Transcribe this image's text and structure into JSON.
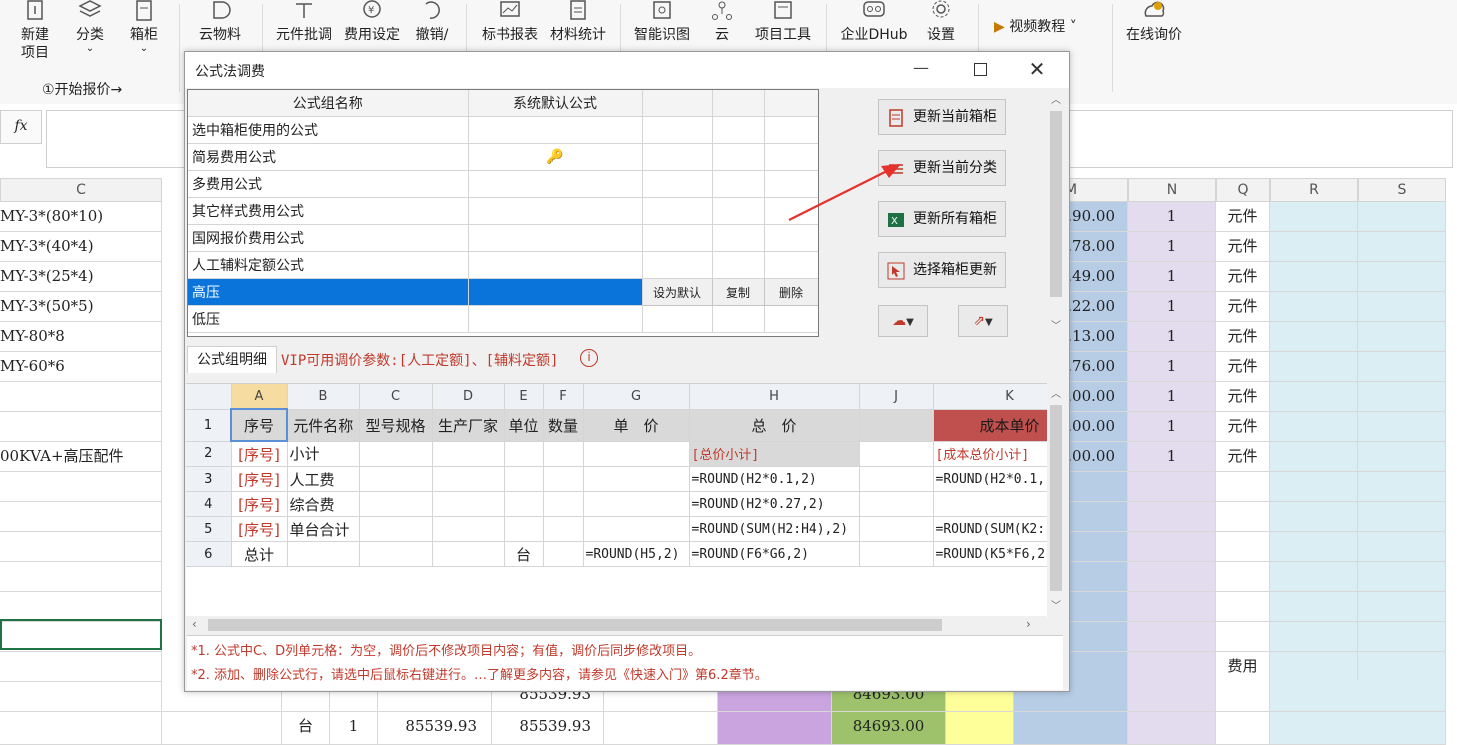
{
  "ribbon": {
    "buttons": [
      {
        "label": "新建\n项目",
        "icon": "new-project-icon"
      },
      {
        "label": "分类",
        "icon": "category-icon"
      },
      {
        "label": "箱柜",
        "icon": "cabinet-icon"
      },
      {
        "label": "云物料",
        "icon": "cloud-material-icon"
      },
      {
        "label": "元件批调",
        "icon": "component-batch-icon"
      },
      {
        "label": "费用设定",
        "icon": "fee-setting-icon"
      },
      {
        "label": "撤销/",
        "icon": "undo-icon"
      },
      {
        "label": "标书报表",
        "icon": "bid-report-icon"
      },
      {
        "label": "材料统计",
        "icon": "material-stats-icon"
      },
      {
        "label": "智能识图",
        "icon": "smart-recognition-icon"
      },
      {
        "label": "云",
        "icon": "cloud-icon"
      },
      {
        "label": "项目工具",
        "icon": "project-tools-icon"
      },
      {
        "label": "企业DHub",
        "icon": "enterprise-dhub-icon"
      },
      {
        "label": "设置",
        "icon": "gear-icon"
      },
      {
        "label": "在线询价",
        "icon": "online-inquiry-icon"
      }
    ],
    "video_tutorial": "视频教程",
    "group_start": "①开始报价→"
  },
  "formula_bar": {
    "fx": "fx"
  },
  "sheet": {
    "col_headers": {
      "c": "C",
      "m": "M",
      "n": "N",
      "q": "Q",
      "r": "R",
      "s": "S"
    },
    "c_cells": [
      "MY-3*(80*10)",
      "MY-3*(40*4)",
      "MY-3*(25*4)",
      "MY-3*(50*5)",
      "MY-80*8",
      "MY-60*6",
      "",
      "",
      "00KVA+高压配件"
    ],
    "m_cells": [
      ".90.00",
      ".78.00",
      ".49.00",
      ".22.00",
      ".13.00",
      ".76.00",
      ".00.00",
      ".00.00",
      ".00.00"
    ],
    "n_cells": [
      "1",
      "1",
      "1",
      "1",
      "1",
      "1",
      "1",
      "1",
      "1"
    ],
    "q_cells": [
      "元件",
      "元件",
      "元件",
      "元件",
      "元件",
      "元件",
      "元件",
      "元件",
      "元件"
    ],
    "q_fee": "费用",
    "bottom_rows": [
      {
        "unit": "",
        "qty": "",
        "price": "",
        "total": "85539.93",
        "cost": "84693.00"
      },
      {
        "unit": "台",
        "qty": "1",
        "price": "85539.93",
        "total": "85539.93",
        "cost": "84693.00"
      }
    ]
  },
  "dialog": {
    "title": "公式法调费",
    "group_table": {
      "headers": [
        "公式组名称",
        "系统默认公式"
      ],
      "rows": [
        "选中箱柜使用的公式",
        "简易费用公式",
        "多费用公式",
        "其它样式费用公式",
        "国网报价费用公式",
        "人工辅料定额公式",
        "高压",
        "低压"
      ],
      "selected_index": 6,
      "row_actions": {
        "set_default": "设为默认",
        "copy": "复制",
        "delete": "删除"
      }
    },
    "side_buttons": [
      "更新当前箱柜",
      "更新当前分类",
      "更新所有箱柜",
      "选择箱柜更新"
    ],
    "detail_label": "公式组明细",
    "vip_note": "VIP可用调价参数:[人工定额]、[辅料定额]",
    "grid": {
      "col_letters": [
        "A",
        "B",
        "C",
        "D",
        "E",
        "F",
        "G",
        "H",
        "J",
        "K"
      ],
      "header_row": [
        "序号",
        "元件名称",
        "型号规格",
        "生产厂家",
        "单位",
        "数量",
        "单　价",
        "总　价",
        "成本单价",
        "成本总价"
      ],
      "rows": [
        {
          "num": "2",
          "a": "[序号]",
          "b": "小计",
          "e": "",
          "g": "",
          "h": "[总价小计]",
          "k": "[成本总价小计]"
        },
        {
          "num": "3",
          "a": "[序号]",
          "b": "人工费",
          "e": "",
          "g": "",
          "h": "=ROUND(H2*0.1,2)",
          "k": "=ROUND(H2*0.1,"
        },
        {
          "num": "4",
          "a": "[序号]",
          "b": "综合费",
          "e": "",
          "g": "",
          "h": "=ROUND(H2*0.27,2)",
          "k": ""
        },
        {
          "num": "5",
          "a": "[序号]",
          "b": "单台合计",
          "e": "",
          "g": "",
          "h": "=ROUND(SUM(H2:H4),2)",
          "k": "=ROUND(SUM(K2:"
        },
        {
          "num": "6",
          "a": "总计",
          "b": "",
          "e": "台",
          "g": "=ROUND(H5,2)",
          "h": "=ROUND(F6*G6,2)",
          "k": "=ROUND(K5*F6,2"
        }
      ]
    },
    "notes": [
      "*1. 公式中C、D列单元格：为空，调价后不修改项目内容；有值，调价后同步修改项目。",
      "*2. 添加、删除公式行，请选中后鼠标右键进行。…了解更多内容，请参见《快速入门》第6.2章节。"
    ]
  }
}
